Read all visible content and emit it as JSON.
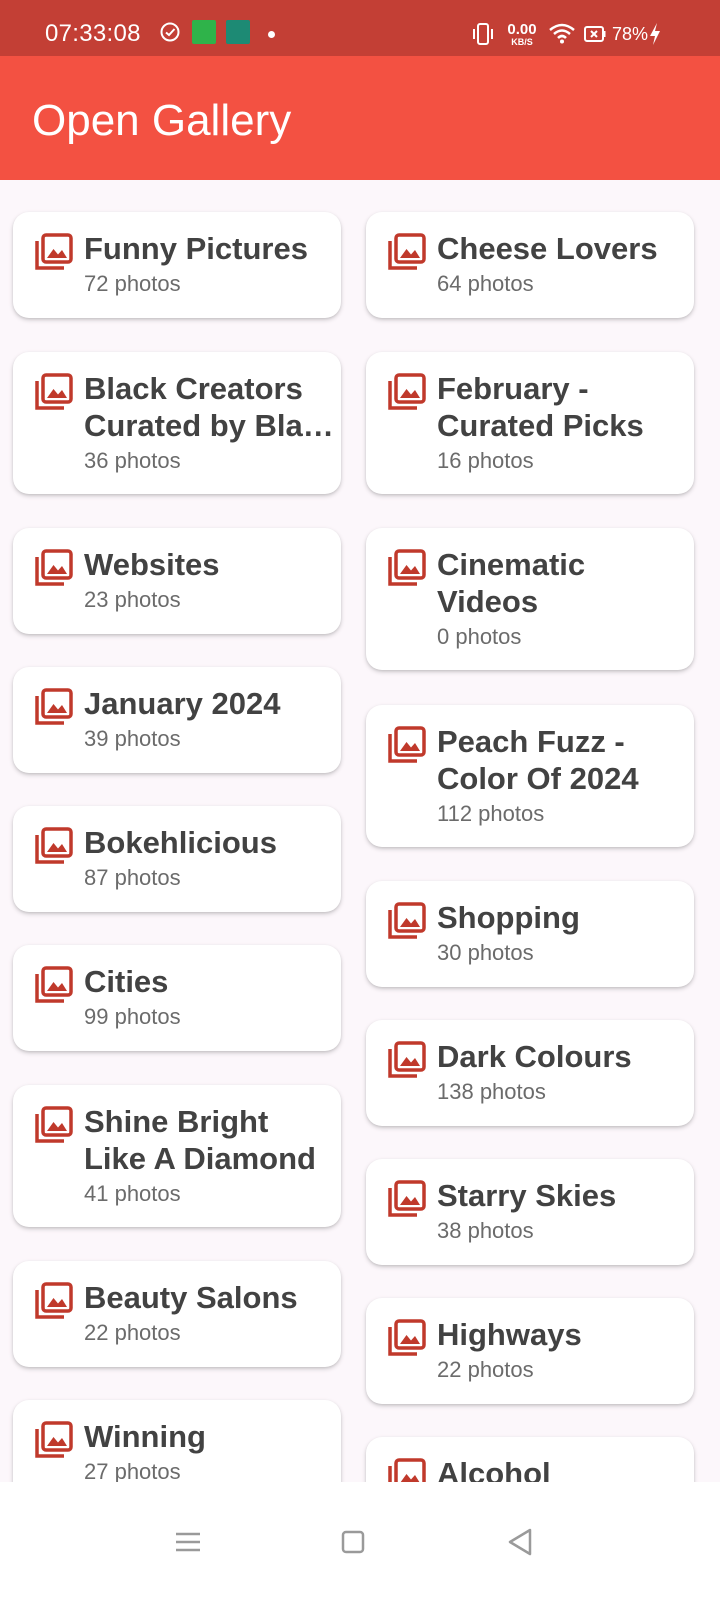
{
  "status_bar": {
    "time": "07:33:08",
    "net_speed_value": "0.00",
    "net_speed_unit": "KB/S",
    "battery": "78%"
  },
  "app_bar": {
    "title": "Open Gallery"
  },
  "albums": [
    {
      "title": "Funny Pictures",
      "count": "72 photos"
    },
    {
      "title": "Cheese Lovers",
      "count": "64 photos"
    },
    {
      "title": "Black Creators Curated by Bla…",
      "count": "36 photos"
    },
    {
      "title": "February - Curated Picks",
      "count": "16 photos"
    },
    {
      "title": "Websites",
      "count": "23 photos"
    },
    {
      "title": "Cinematic Videos",
      "count": "0 photos"
    },
    {
      "title": "January 2024",
      "count": "39 photos"
    },
    {
      "title": "Peach Fuzz - Color Of 2024",
      "count": "112 photos"
    },
    {
      "title": "Bokehlicious",
      "count": "87 photos"
    },
    {
      "title": "Shopping",
      "count": "30 photos"
    },
    {
      "title": "Cities",
      "count": "99 photos"
    },
    {
      "title": "Dark Colours",
      "count": "138 photos"
    },
    {
      "title": "Shine Bright Like A Diamond",
      "count": "41 photos"
    },
    {
      "title": "Starry Skies",
      "count": "38 photos"
    },
    {
      "title": "Beauty Salons",
      "count": "22 photos"
    },
    {
      "title": "Highways",
      "count": "22 photos"
    },
    {
      "title": "Winning",
      "count": "27 photos"
    },
    {
      "title": "Alcohol",
      "count": ""
    }
  ],
  "colors": {
    "accent": "#f35142",
    "status_bar": "#c33f35",
    "icon": "#c0392b"
  },
  "icons": {
    "album": "photo-library-icon",
    "nav_menu": "menu-icon",
    "nav_home": "square-icon",
    "nav_back": "back-triangle-icon"
  }
}
